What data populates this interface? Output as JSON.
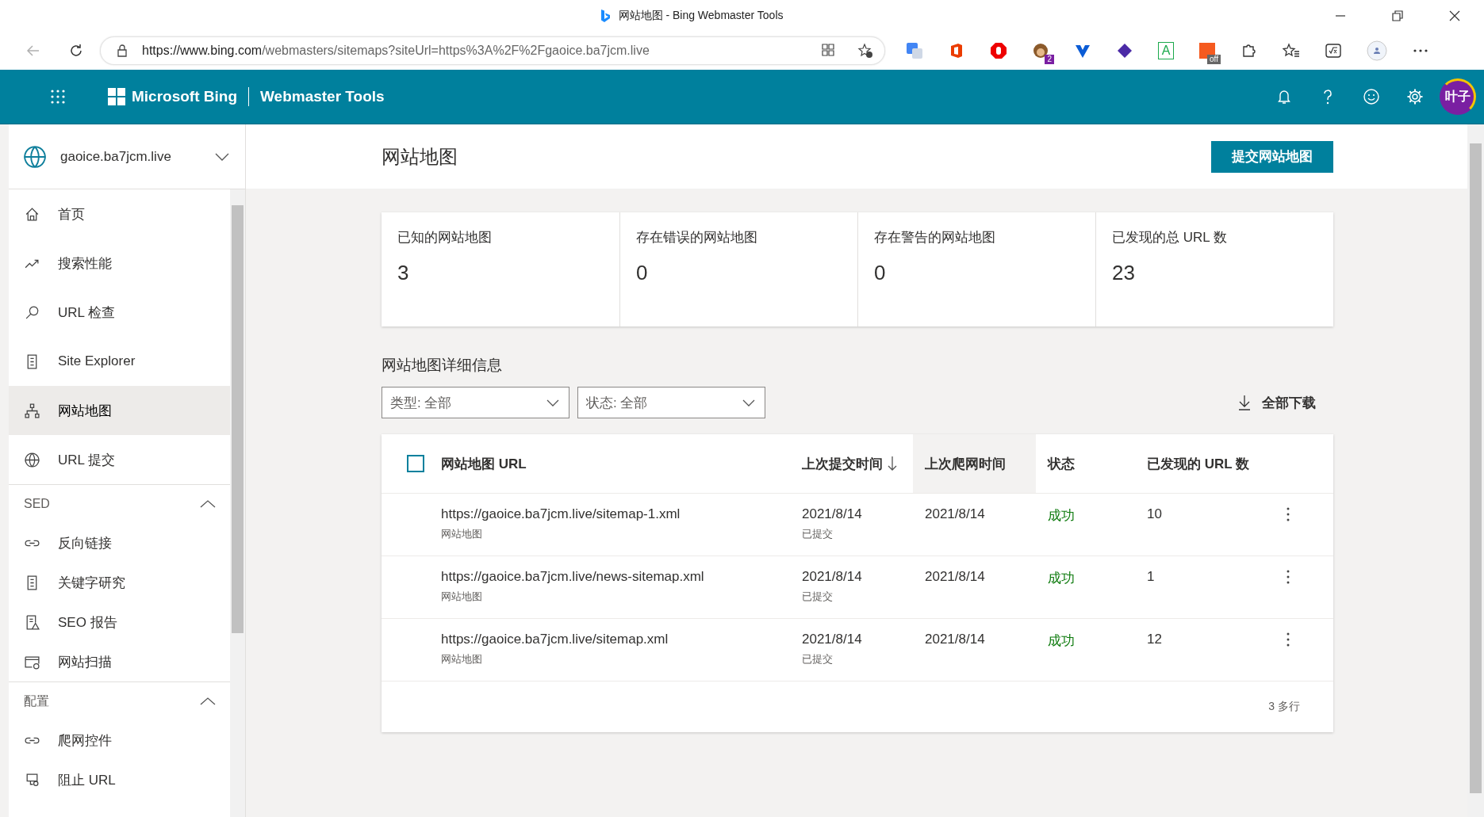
{
  "browser": {
    "tab_title": "网站地图 - Bing Webmaster Tools",
    "url_host": "https://www.bing.com",
    "url_path": "/webmasters/sitemaps?siteUrl=https%3A%2F%2Fgaoice.ba7jcm.live",
    "letter_icon": "A",
    "extension_badges": [
      "2",
      "off"
    ]
  },
  "header": {
    "brand": "Microsoft Bing",
    "product": "Webmaster Tools",
    "avatar": "叶子"
  },
  "sidebar": {
    "site": "gaoice.ba7jcm.live",
    "groups": [
      {
        "items": [
          {
            "label": "首页",
            "selected": false
          },
          {
            "label": "搜索性能",
            "selected": false
          },
          {
            "label": "URL 检查",
            "selected": false
          },
          {
            "label": "Site Explorer",
            "selected": false
          },
          {
            "label": "网站地图",
            "selected": true
          },
          {
            "label": "URL 提交",
            "selected": false
          }
        ]
      },
      {
        "heading": "SED",
        "expanded": true,
        "items": [
          {
            "label": "反向链接",
            "selected": false
          },
          {
            "label": "关键字研究",
            "selected": false
          },
          {
            "label": "SEO 报告",
            "selected": false
          },
          {
            "label": "网站扫描",
            "selected": false
          }
        ]
      },
      {
        "heading": "配置",
        "expanded": true,
        "items": [
          {
            "label": "爬网控件",
            "selected": false
          },
          {
            "label": "阻止 URL",
            "selected": false
          }
        ]
      }
    ]
  },
  "page": {
    "title": "网站地图",
    "submit_button": "提交网站地图"
  },
  "stats": [
    {
      "label": "已知的网站地图",
      "value": "3"
    },
    {
      "label": "存在错误的网站地图",
      "value": "0"
    },
    {
      "label": "存在警告的网站地图",
      "value": "0"
    },
    {
      "label": "已发现的总 URL 数",
      "value": "23"
    }
  ],
  "details": {
    "title": "网站地图详细信息",
    "filters": [
      {
        "label": "类型: 全部"
      },
      {
        "label": "状态: 全部"
      }
    ],
    "download": "全部下载"
  },
  "table": {
    "select_all": false,
    "columns": [
      {
        "label": "网站地图 URL",
        "sorted": false,
        "hovered": false
      },
      {
        "label": "上次提交时间",
        "sorted": true,
        "hovered": false
      },
      {
        "label": "上次爬网时间",
        "sorted": false,
        "hovered": true
      },
      {
        "label": "状态",
        "sorted": false,
        "hovered": false
      },
      {
        "label": "已发现的 URL 数",
        "sorted": false,
        "hovered": false
      }
    ],
    "rows": [
      {
        "url": "https://gaoice.ba7jcm.live/sitemap-1.xml",
        "type": "网站地图",
        "submitted": "2021/8/14",
        "submitted_note": "已提交",
        "crawled": "2021/8/14",
        "status": "成功",
        "color": "#107c10",
        "count": "10"
      },
      {
        "url": "https://gaoice.ba7jcm.live/news-sitemap.xml",
        "type": "网站地图",
        "submitted": "2021/8/14",
        "submitted_note": "已提交",
        "crawled": "2021/8/14",
        "status": "成功",
        "color": "#107c10",
        "count": "1"
      },
      {
        "url": "https://gaoice.ba7jcm.live/sitemap.xml",
        "type": "网站地图",
        "submitted": "2021/8/14",
        "submitted_note": "已提交",
        "crawled": "2021/8/14",
        "status": "成功",
        "color": "#107c10",
        "count": "12"
      }
    ],
    "footer": "3 多行"
  }
}
